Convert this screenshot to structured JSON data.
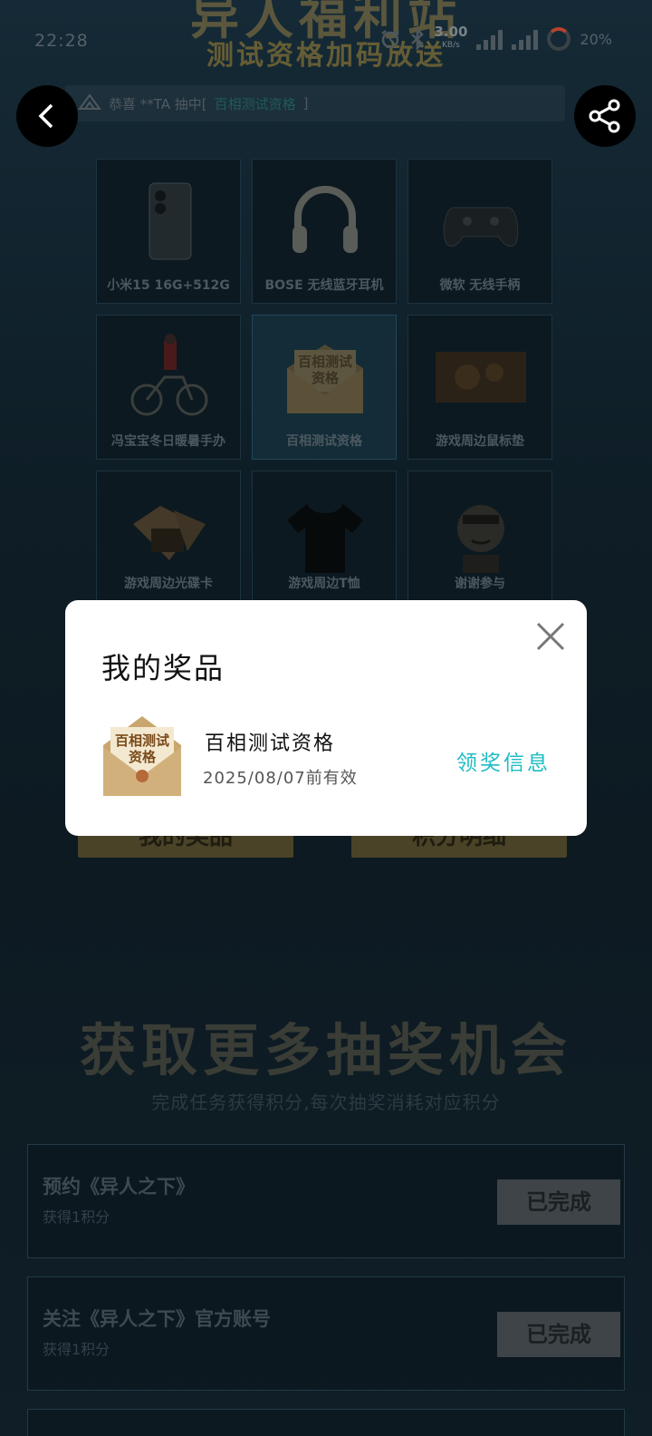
{
  "banner": {
    "title": "异人福利站",
    "subtitle": "测试资格加码放送"
  },
  "status_bar": {
    "time": "22:28",
    "speed": "3.00",
    "speed_unit": "KB/s",
    "net1": "5G",
    "net2": "5G",
    "battery": "20%"
  },
  "ticker": {
    "prefix": "恭喜 **TA 抽中[",
    "highlight": "百相测试资格",
    "suffix": "]"
  },
  "prizes": [
    {
      "label": "小米15 16G+512G",
      "icon": "phone-icon"
    },
    {
      "label": "BOSE 无线蓝牙耳机",
      "icon": "headphones-icon"
    },
    {
      "label": "微软 无线手柄",
      "icon": "gamepad-icon"
    },
    {
      "label": "冯宝宝冬日暖暑手办",
      "icon": "figure-icon"
    },
    {
      "label": "百相测试资格",
      "icon": "envelope-icon"
    },
    {
      "label": "游戏周边鼠标垫",
      "icon": "mousepad-icon"
    },
    {
      "label": "游戏周边光碟卡",
      "icon": "card-icon"
    },
    {
      "label": "游戏周边T恤",
      "icon": "tshirt-icon"
    },
    {
      "label": "谢谢参与",
      "icon": "thanks-icon"
    }
  ],
  "actions": {
    "my_prizes": "我的奖品",
    "points_detail": "积分明细"
  },
  "more": {
    "title": "获取更多抽奖机会",
    "subtitle": "完成任务获得积分,每次抽奖消耗对应积分",
    "tasks": [
      {
        "title": "预约《异人之下》",
        "reward": "获得1积分",
        "status": "已完成"
      },
      {
        "title": "关注《异人之下》官方账号",
        "reward": "获得1积分",
        "status": "已完成"
      }
    ]
  },
  "modal": {
    "title": "我的奖品",
    "thumb_text": "百相测试资格",
    "prize_name": "百相测试资格",
    "valid_until": "2025/08/07前有效",
    "claim_label": "领奖信息"
  },
  "colors": {
    "accent": "#1ebcc4",
    "modal_bg": "#ffffff"
  }
}
